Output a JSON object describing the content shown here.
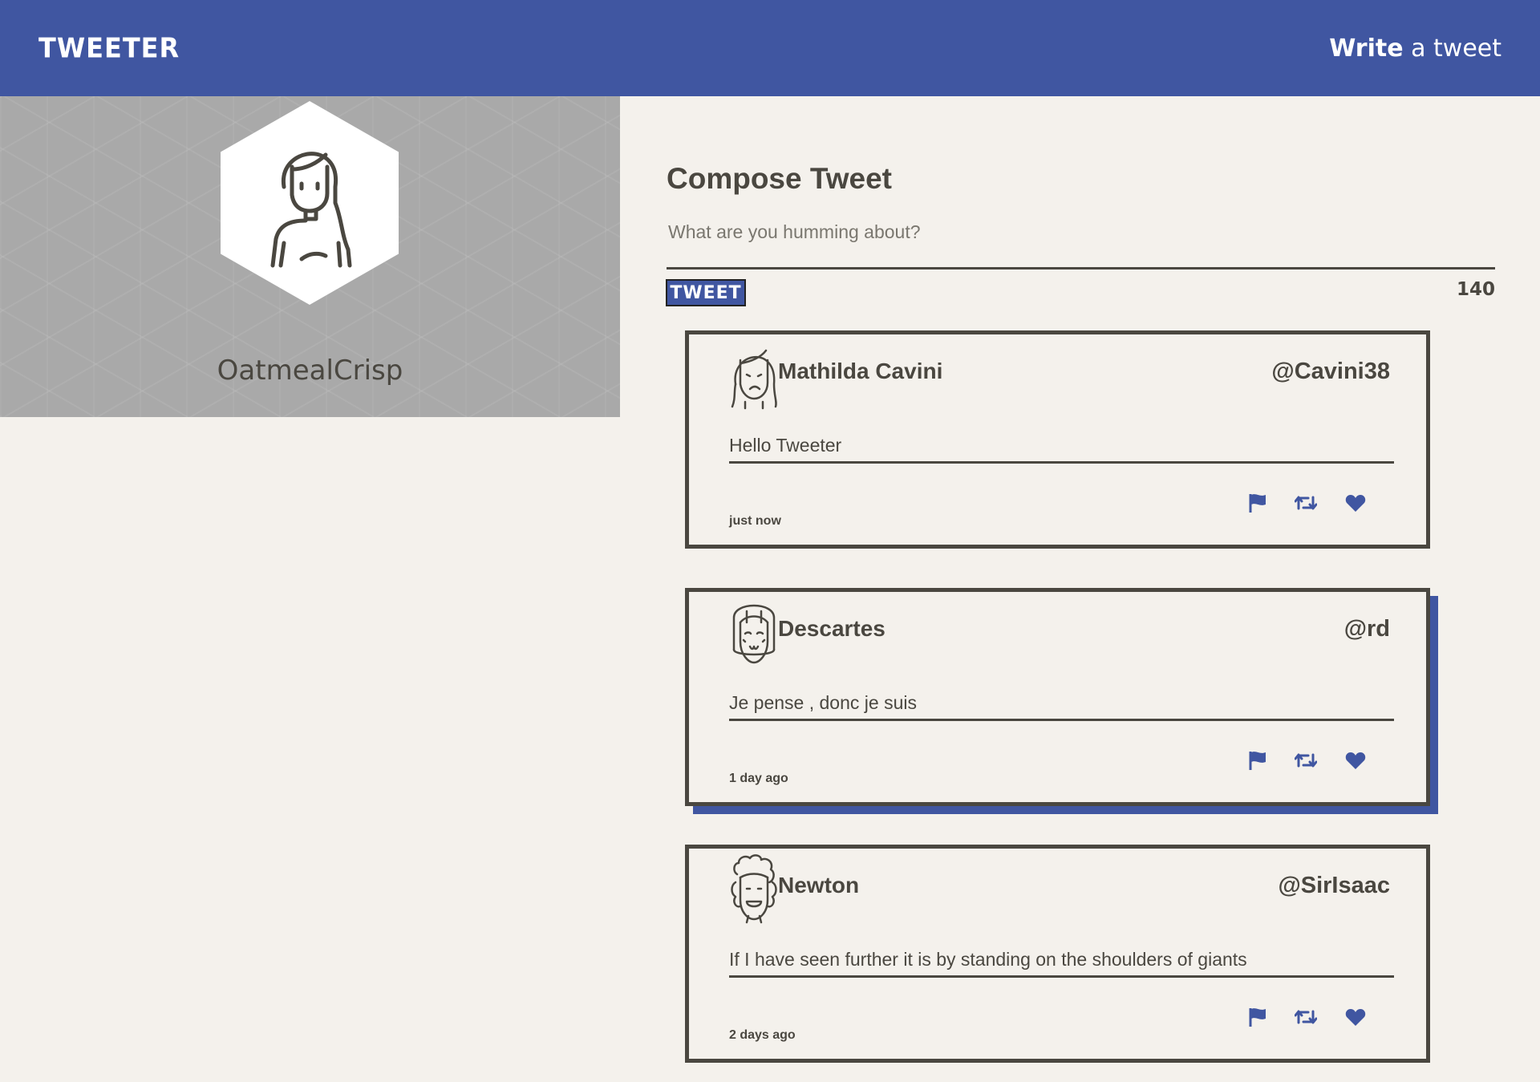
{
  "nav": {
    "brand": "TWEETER",
    "compose_bold": "Write",
    "compose_rest": " a tweet"
  },
  "profile": {
    "username": "OatmealCrisp"
  },
  "compose": {
    "title": "Compose Tweet",
    "placeholder": "What are you humming about?",
    "button_label": "TWEET",
    "char_count": "140"
  },
  "tweets": [
    {
      "name": "Mathilda Cavini",
      "handle": "@Cavini38",
      "content": "Hello Tweeter",
      "time": "just now",
      "avatar": "woman-avatar-icon"
    },
    {
      "name": "Descartes",
      "handle": "@rd",
      "content": "Je pense , donc je suis",
      "time": "1 day ago",
      "avatar": "man-bangs-avatar-icon"
    },
    {
      "name": "Newton",
      "handle": "@SirIsaac",
      "content": "If I have seen further it is by standing on the shoulders of giants",
      "time": "2 days ago",
      "avatar": "curly-hair-avatar-icon"
    }
  ],
  "actions": [
    "flag-icon",
    "retweet-icon",
    "heart-icon"
  ],
  "colors": {
    "primary": "#4056a1",
    "background": "#f4f1ec",
    "text": "#4a4740",
    "profile_bg": "#a9a9a9"
  }
}
